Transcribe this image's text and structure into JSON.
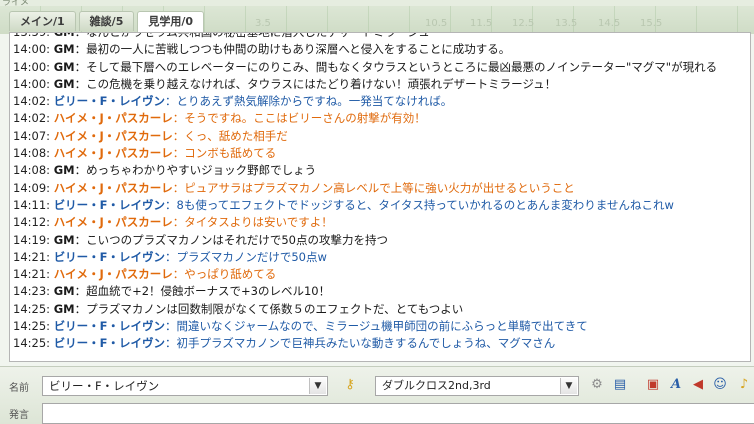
{
  "window": {
    "top_label": "ライメ"
  },
  "tabs": [
    {
      "label": "メイン/1",
      "active": false
    },
    {
      "label": "雑談/5",
      "active": false
    },
    {
      "label": "見学用/0",
      "active": true
    }
  ],
  "messages": [
    {
      "time": "13:59",
      "name": "GM",
      "role": "gm",
      "text": "なんとかラゼラム共和国の秘密基地に潜入したデザートミラージュ"
    },
    {
      "time": "14:00",
      "name": "GM",
      "role": "gm",
      "text": "最初の一人に苦戦しつつも仲間の助けもあり深層へと侵入をすることに成功する。"
    },
    {
      "time": "14:00",
      "name": "GM",
      "role": "gm",
      "text": "そして最下層へのエレベーターにのりこみ、間もなくタウラスというところに最凶最悪のノインテーター\"マグマ\"が現れる"
    },
    {
      "time": "14:00",
      "name": "GM",
      "role": "gm",
      "text": "この危機を乗り越えなければ、タウラスにはたどり着けない！頑張れデザートミラージュ！"
    },
    {
      "time": "14:02",
      "name": "ビリー・F・レイヴン",
      "role": "billy",
      "text": "とりあえず熱気解除からですね。一発当てなければ。"
    },
    {
      "time": "14:02",
      "name": "ハイメ・J・パスカーレ",
      "role": "jaime",
      "text": "そうですね。ここはビリーさんの射撃が有効！"
    },
    {
      "time": "14:07",
      "name": "ハイメ・J・パスカーレ",
      "role": "jaime",
      "text": "くっ、舐めた相手だ"
    },
    {
      "time": "14:08",
      "name": "ハイメ・J・パスカーレ",
      "role": "jaime",
      "text": "コンボも舐めてる"
    },
    {
      "time": "14:08",
      "name": "GM",
      "role": "gm",
      "text": "めっちゃわかりやすいジョック野郎でしょう"
    },
    {
      "time": "14:09",
      "name": "ハイメ・J・パスカーレ",
      "role": "jaime",
      "text": "ピュアサラはプラズマカノン高レベルで上等に強い火力が出せるということ"
    },
    {
      "time": "14:11",
      "name": "ビリー・F・レイヴン",
      "role": "billy",
      "text": "8も使ってエフェクトでドッジすると、タイタス持っていかれるのとあんま変わりませんねこれw"
    },
    {
      "time": "14:12",
      "name": "ハイメ・J・パスカーレ",
      "role": "jaime",
      "text": "タイタスよりは安いですよ！"
    },
    {
      "time": "14:19",
      "name": "GM",
      "role": "gm",
      "text": "こいつのプラズマカノンはそれだけで50点の攻撃力を持つ"
    },
    {
      "time": "14:21",
      "name": "ビリー・F・レイヴン",
      "role": "billy",
      "text": "プラズマカノンだけで50点w"
    },
    {
      "time": "14:21",
      "name": "ハイメ・J・パスカーレ",
      "role": "jaime",
      "text": "やっぱり舐めてる"
    },
    {
      "time": "14:23",
      "name": "GM",
      "role": "gm",
      "text": "超血統で+2！侵蝕ボーナスで+3のレベル10！"
    },
    {
      "time": "14:25",
      "name": "GM",
      "role": "gm",
      "text": "プラズマカノンは回数制限がなくて係数５のエフェクトだ、とてもつよい"
    },
    {
      "time": "14:25",
      "name": "ビリー・F・レイヴン",
      "role": "billy",
      "text": "間違いなくジャームなので、ミラージュ機甲師団の前にふらっと単騎で出てきて"
    },
    {
      "time": "14:25",
      "name": "ビリー・F・レイヴン",
      "role": "billy",
      "text": "初手プラズマカノンで巨神兵みたいな動きするんでしょうね、マグマさん"
    }
  ],
  "input": {
    "name_label": "名前",
    "name_value": "ビリー・F・レイヴン",
    "system_value": "ダブルクロス2nd,3rd",
    "message_label": "発言",
    "message_value": ""
  },
  "colors": {
    "gm": "#1a1a1a",
    "billy": "#1f5aa6",
    "jaime": "#e06a0c"
  },
  "icons": [
    "key-icon",
    "dice-settings-icon",
    "book-icon",
    "note-icon",
    "font-icon",
    "sound-icon",
    "users-icon",
    "bell-icon"
  ]
}
